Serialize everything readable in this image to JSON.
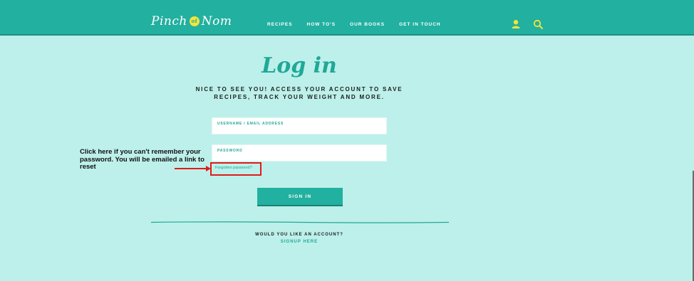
{
  "header": {
    "logo_left": "Pinch",
    "logo_mid": "of",
    "logo_right": "Nom",
    "nav": [
      "RECIPES",
      "HOW TO'S",
      "OUR BOOKS",
      "GET IN TOUCH"
    ],
    "icons": [
      "user-icon",
      "search-icon"
    ]
  },
  "page": {
    "title": "Log in",
    "subtitle": "NICE TO SEE YOU! ACCESS YOUR ACCOUNT TO SAVE RECIPES, TRACK YOUR WEIGHT AND MORE."
  },
  "form": {
    "username_label": "USERNAME / EMAIL ADDRESS",
    "password_label": "PASSWORD",
    "forgot_link": "Forgotten password?",
    "signin_label": "SIGN IN"
  },
  "footer": {
    "question": "WOULD YOU LIKE AN ACCOUNT?",
    "signup_link": "SIGNUP HERE"
  },
  "annotation": {
    "text": "Click here if you can't remember your password. You will be emailed a link to reset"
  },
  "colors": {
    "header": "#22b0a0",
    "background": "#bdf0ea",
    "accent": "#1fa898",
    "highlight": "#e01b1b",
    "icon": "#f3e53a"
  }
}
